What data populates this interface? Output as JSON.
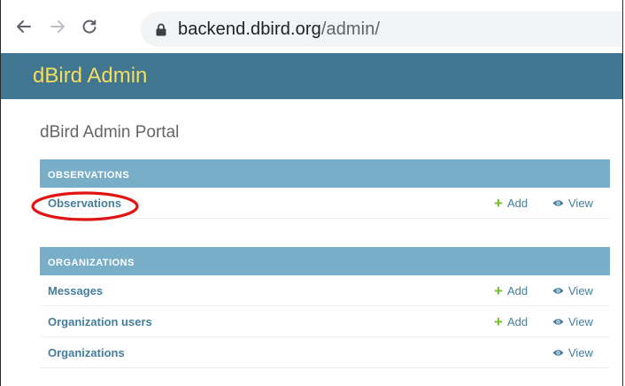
{
  "browser": {
    "url_host": "backend.dbird.org",
    "url_path": "/admin/",
    "icons": {
      "back": "back-arrow-icon",
      "forward": "forward-arrow-icon",
      "reload": "reload-icon",
      "lock": "lock-icon"
    }
  },
  "header": {
    "site_name": "dBird Admin"
  },
  "page": {
    "title": "dBird Admin Portal"
  },
  "modules": [
    {
      "caption": "Observations",
      "rows": [
        {
          "name": "Observations",
          "add": "Add",
          "view": "View"
        }
      ]
    },
    {
      "caption": "Organizations",
      "rows": [
        {
          "name": "Messages",
          "add": "Add",
          "view": "View"
        },
        {
          "name": "Organization users",
          "add": "Add",
          "view": "View"
        },
        {
          "name": "Organizations",
          "view": "View"
        }
      ]
    }
  ],
  "colors": {
    "header_bg": "#417690",
    "site_name": "#f5dd5d",
    "caption_bg": "#79aec8",
    "link": "#447e9b",
    "add_plus": "#70bf2b",
    "annotation": "#e01414"
  }
}
